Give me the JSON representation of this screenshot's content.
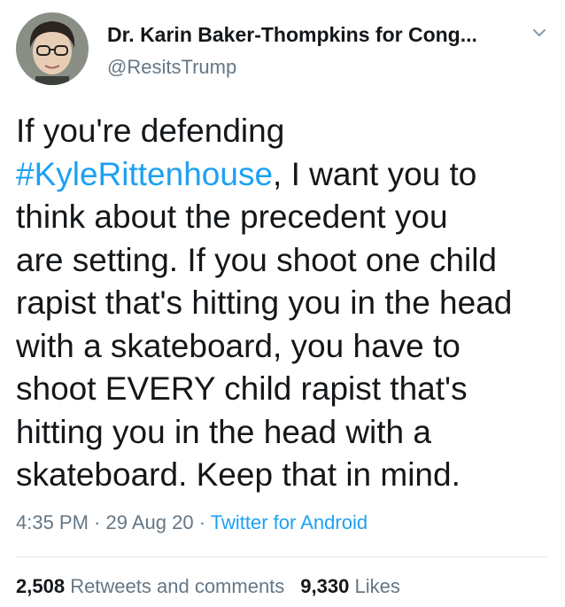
{
  "author": {
    "display_name": "Dr. Karin Baker-Thompkins for Cong...",
    "handle": "@ResitsTrump"
  },
  "tweet": {
    "line1": "If you're defending",
    "hashtag": "#KyleRittenhouse",
    "line2_rest": ", I want you to",
    "line3": "think about the precedent you",
    "line4": "are setting. If you shoot one child",
    "line5": "rapist that's hitting you in the head",
    "line6": "with a skateboard, you have to",
    "line7": "shoot EVERY child rapist that's",
    "line8": "hitting you in the head with a",
    "line9": "skateboard. Keep that in mind."
  },
  "meta": {
    "time": "4:35 PM",
    "sep1": " · ",
    "date": "29 Aug 20",
    "sep2": " · ",
    "source": "Twitter for Android"
  },
  "stats": {
    "retweets_count": "2,508",
    "retweets_label": "Retweets and comments",
    "likes_count": "9,330",
    "likes_label": "Likes"
  },
  "icons": {
    "menu": "chevron-down-icon",
    "avatar": "profile-photo"
  },
  "colors": {
    "link": "#1da1f2",
    "text": "#14171a",
    "muted": "#657786"
  }
}
